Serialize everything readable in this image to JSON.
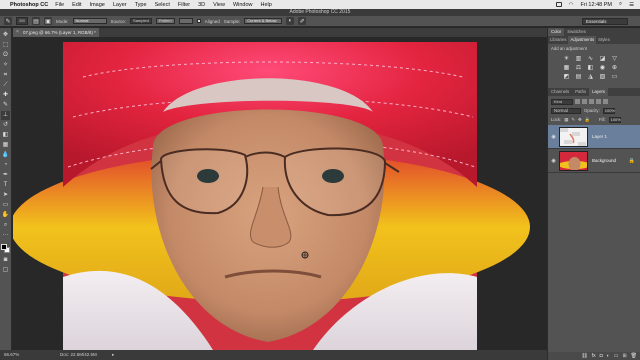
{
  "menubar": {
    "apple": "",
    "app": "Photoshop CC",
    "items": [
      "File",
      "Edit",
      "Image",
      "Layer",
      "Type",
      "Select",
      "Filter",
      "3D",
      "View",
      "Window",
      "Help"
    ],
    "clock": "Fri 12:48 PM"
  },
  "window": {
    "title": "Adobe Photoshop CC 2015"
  },
  "options": {
    "brush_size": "200",
    "mode_label": "Mode:",
    "mode_value": "Normal",
    "source_label": "Source:",
    "source_sampled": "Sampled",
    "source_pattern": "Pattern",
    "aligned_label": "Aligned",
    "sample_label": "Sample:",
    "sample_value": "Current & Below",
    "workspace": "Essentials"
  },
  "document": {
    "tab_title": "07.jpeg @ 66.7% (Layer 1, RGB/8) *",
    "zoom": "66.67%",
    "doc_size": "Doc: 22.5M/42.5M"
  },
  "panels": {
    "top_tabs": [
      "Color",
      "Swatches"
    ],
    "mid_tabs": [
      "Libraries",
      "Adjustments",
      "Styles"
    ],
    "add_adjustment": "Add an adjustment",
    "layer_tabs": [
      "Channels",
      "Paths",
      "Layers"
    ],
    "kind": "Kind",
    "blend_mode": "Normal",
    "opacity_label": "Opacity:",
    "opacity_value": "100%",
    "lock_label": "Lock:",
    "fill_label": "Fill:",
    "fill_value": "100%",
    "layers": [
      {
        "name": "Layer 1",
        "selected": true
      },
      {
        "name": "Background",
        "selected": false
      }
    ]
  },
  "colors": {
    "hat_red": "#e8243f",
    "hat_yellow": "#f2c21c",
    "skin": "#c48a68",
    "layer_highlight": "#6a7f9b"
  }
}
